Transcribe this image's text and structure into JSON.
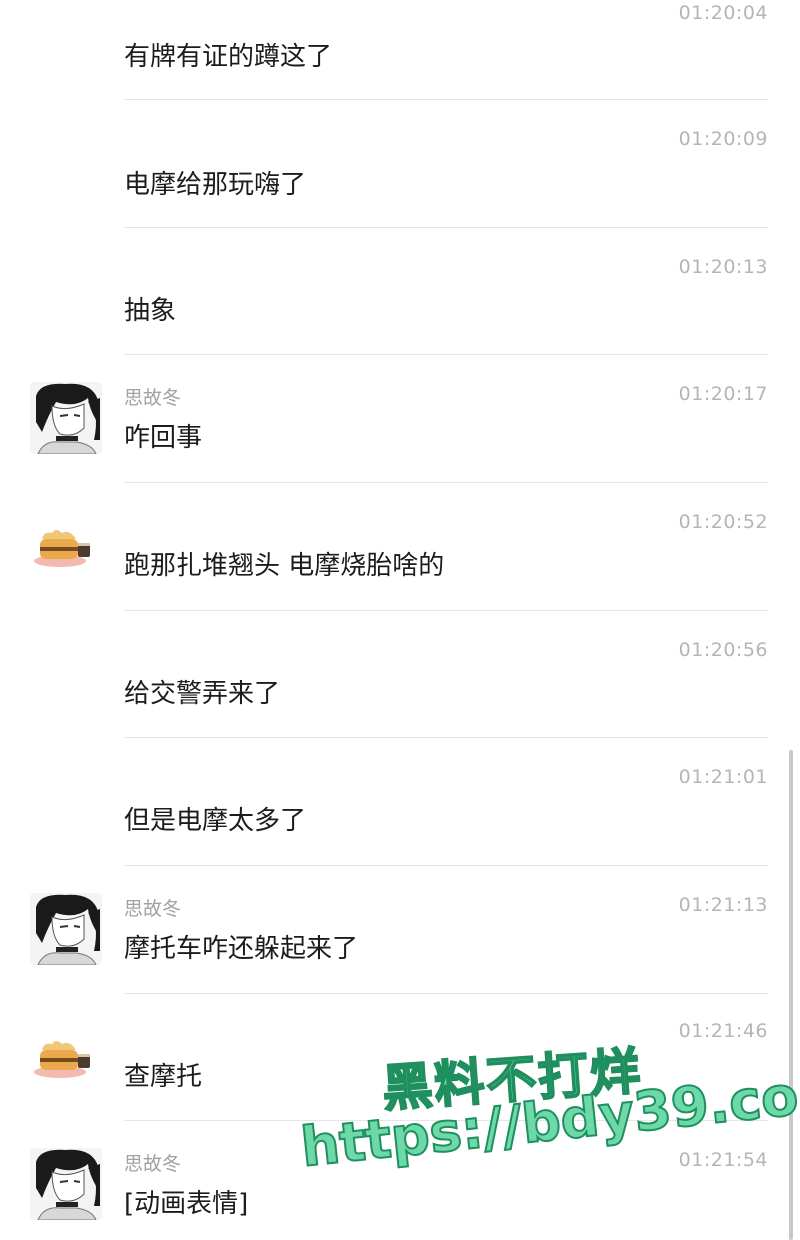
{
  "messages": [
    {
      "avatar": null,
      "sender": "",
      "time": "01:20:04",
      "text": "有牌有证的蹲这了"
    },
    {
      "avatar": null,
      "sender": "",
      "time": "01:20:09",
      "text": "电摩给那玩嗨了"
    },
    {
      "avatar": null,
      "sender": "",
      "time": "01:20:13",
      "text": "抽象"
    },
    {
      "avatar": "anime-portrait",
      "sender": "思故冬",
      "time": "01:20:17",
      "text": "咋回事"
    },
    {
      "avatar": "cake",
      "sender": "",
      "time": "01:20:52",
      "text": "跑那扎堆翘头 电摩烧胎啥的"
    },
    {
      "avatar": null,
      "sender": "",
      "time": "01:20:56",
      "text": "给交警弄来了"
    },
    {
      "avatar": null,
      "sender": "",
      "time": "01:21:01",
      "text": "但是电摩太多了"
    },
    {
      "avatar": "anime-portrait",
      "sender": "思故冬",
      "time": "01:21:13",
      "text": "摩托车咋还躲起来了"
    },
    {
      "avatar": "cake",
      "sender": "",
      "time": "01:21:46",
      "text": "查摩托"
    },
    {
      "avatar": "anime-portrait",
      "sender": "思故冬",
      "time": "01:21:54",
      "text": "[动画表情]"
    }
  ],
  "watermark": {
    "line1": "黑料不打烊",
    "line2": "https://bdy39.co"
  },
  "colors": {
    "text": "#1c1c1c",
    "meta": "#b5b5b5",
    "divider": "#e6e6e6",
    "watermark_fill": "#6dd9a8",
    "watermark_stroke": "#1f8f5f"
  }
}
